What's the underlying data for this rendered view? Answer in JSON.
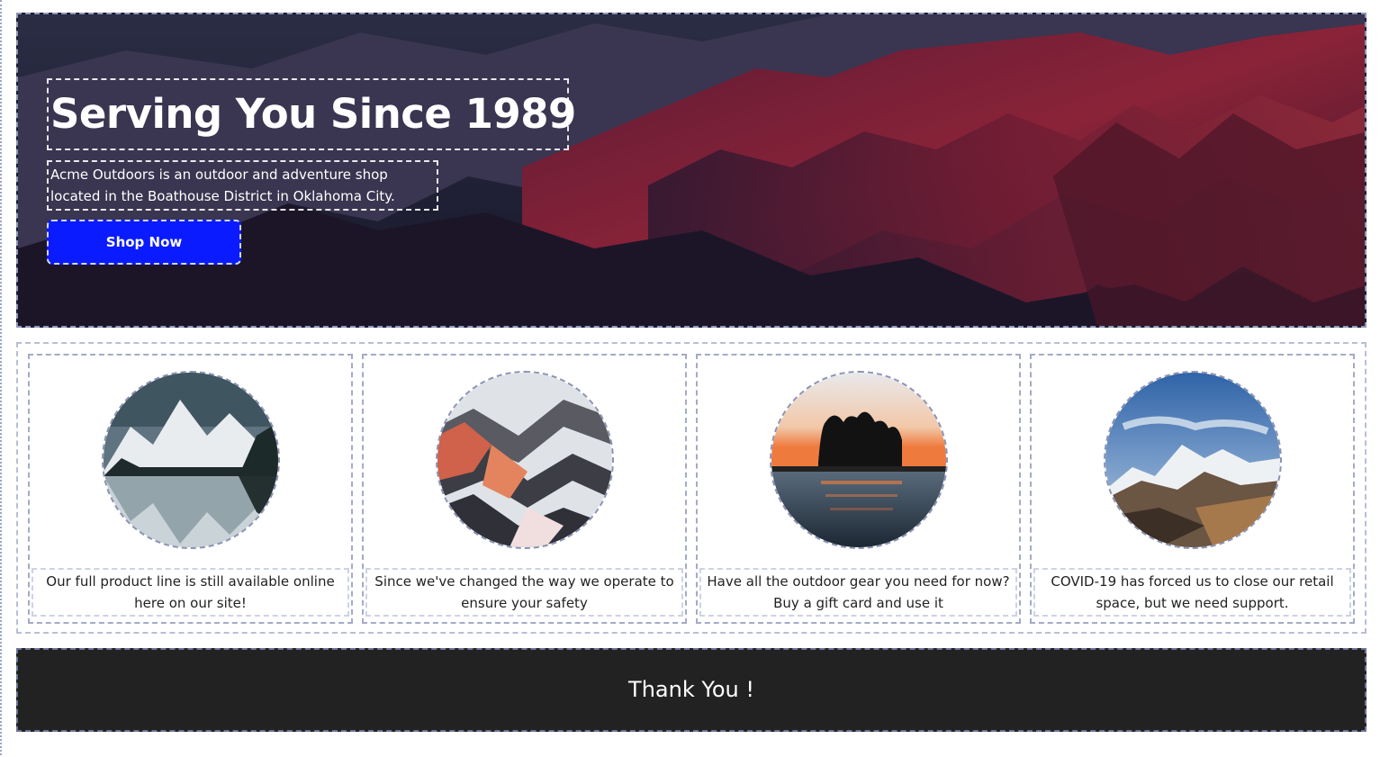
{
  "hero": {
    "title": "Serving You Since 1989",
    "description": "Acme Outdoors is an outdoor and adventure shop located in the Boathouse District in Oklahoma City.",
    "cta_label": "Shop Now",
    "cta_color": "#0a1bff",
    "background_image": "dark red mountain range"
  },
  "cards": [
    {
      "image": "snowy mountains reflected in lake",
      "caption": "Our full product line is still available online here on our site!"
    },
    {
      "image": "snow-covered ridges at sunset",
      "caption": "Since we've changed the way we operate to ensure your safety"
    },
    {
      "image": "tree island silhouette at sunset over water",
      "caption": "Have all the outdoor gear you need for now? Buy a gift card and use it"
    },
    {
      "image": "snowy mountain peaks under blue sky",
      "caption": "COVID-19 has forced us to close our retail space, but we need support."
    }
  ],
  "footer": {
    "text": "Thank You !",
    "background": "#222222"
  }
}
